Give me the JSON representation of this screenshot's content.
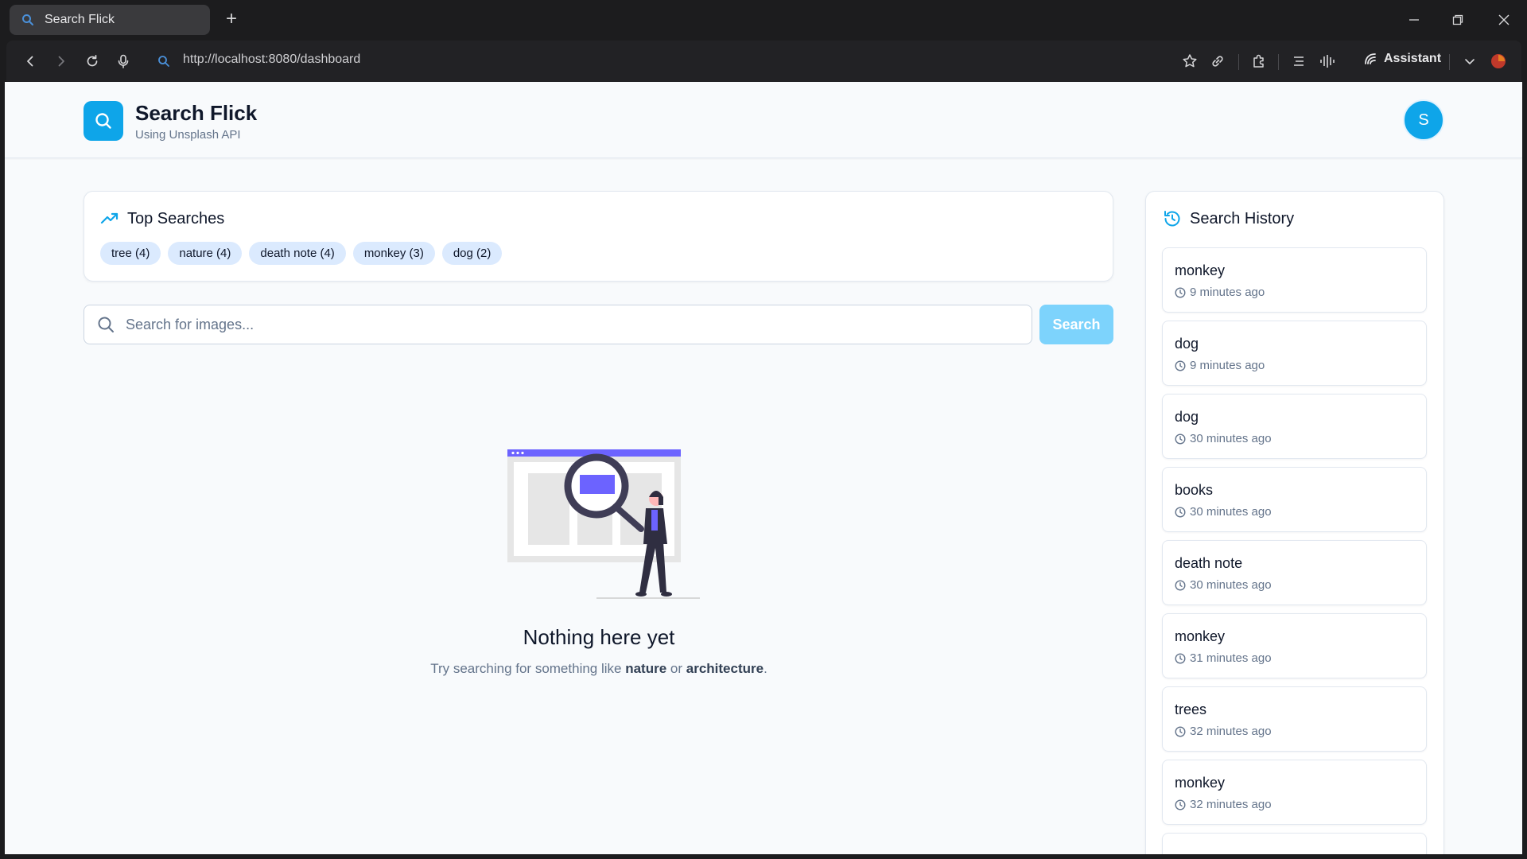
{
  "browser": {
    "tab_title": "Search Flick",
    "url": "http://localhost:8080/dashboard",
    "assistant_label": "Assistant"
  },
  "header": {
    "title": "Search Flick",
    "subtitle": "Using Unsplash API",
    "avatar_initial": "S"
  },
  "top_searches": {
    "title": "Top Searches",
    "chips": [
      "tree (4)",
      "nature (4)",
      "death note (4)",
      "monkey (3)",
      "dog (2)"
    ]
  },
  "search": {
    "placeholder": "Search for images...",
    "button_label": "Search"
  },
  "empty_state": {
    "title": "Nothing here yet",
    "text_prefix": "Try searching for something like ",
    "example1": "nature",
    "text_middle": " or ",
    "example2": "architecture",
    "text_suffix": "."
  },
  "history": {
    "title": "Search History",
    "items": [
      {
        "term": "monkey",
        "time": "9 minutes ago"
      },
      {
        "term": "dog",
        "time": "9 minutes ago"
      },
      {
        "term": "dog",
        "time": "30 minutes ago"
      },
      {
        "term": "books",
        "time": "30 minutes ago"
      },
      {
        "term": "death note",
        "time": "30 minutes ago"
      },
      {
        "term": "monkey",
        "time": "31 minutes ago"
      },
      {
        "term": "trees",
        "time": "32 minutes ago"
      },
      {
        "term": "monkey",
        "time": "32 minutes ago"
      }
    ]
  },
  "colors": {
    "accent": "#0ea5e9",
    "chip_bg": "#dbeafe",
    "search_button": "#7dd3fc",
    "illustration_accent": "#6c63ff"
  },
  "icons": {
    "tab": "search-icon",
    "logo": "search-icon",
    "top_searches": "trending-up-icon",
    "history": "history-icon",
    "history_time": "clock-icon"
  }
}
